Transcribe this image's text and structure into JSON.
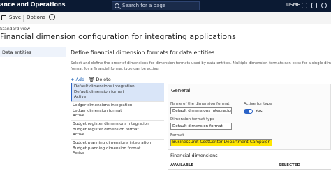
{
  "topbar": {
    "app_title": "ance and Operations",
    "search_placeholder": "Search for a page",
    "company": "USMF"
  },
  "actionbar": {
    "save_label": "Save",
    "options_label": "Options"
  },
  "breadcrumb": "Standard view",
  "page_title": "Financial dimension configuration for integrating applications",
  "leftnav": {
    "items": [
      {
        "label": "Data entities"
      }
    ]
  },
  "main": {
    "section_title": "Define financial dimension formats for data entities",
    "description_lines": [
      "Select and define the order of dimensions for dimension formats used by data entities. Multiple dimension formats can exist for a single dimension format t",
      "format for a financial format type can be active."
    ],
    "list_actions": {
      "add_label": "+ Add",
      "delete_label": "Delete"
    },
    "format_list": [
      {
        "line1": "Default dimensions integration",
        "line2": "Default dimension format",
        "line3": "Active"
      },
      {
        "line1": "Ledger dimensions integration",
        "line2": "Ledger dimension format",
        "line3": "Active"
      },
      {
        "line1": "Budget register dimensions integration",
        "line2": "Budget register dimension format",
        "line3": "Active"
      },
      {
        "line1": "Budget planning dimensions integration",
        "line2": "Budget planning dimension format",
        "line3": "Active"
      }
    ]
  },
  "general": {
    "title": "General",
    "name_label": "Name of the dimension format",
    "name_value": "Default dimensions integration",
    "active_label": "Active for type",
    "active_value": "Yes",
    "type_label": "Dimension format type",
    "type_value": "Default dimension format",
    "format_label": "Format",
    "format_value": "BusinessUnit-CostCenter-Department-Campaign"
  },
  "financial_dimensions": {
    "title": "Financial dimensions",
    "columns": [
      "AVAILABLE",
      "SELECTED"
    ]
  },
  "colors": {
    "topbar": "#0b1a33",
    "accent": "#2b63c6",
    "highlight": "#ffe600"
  }
}
